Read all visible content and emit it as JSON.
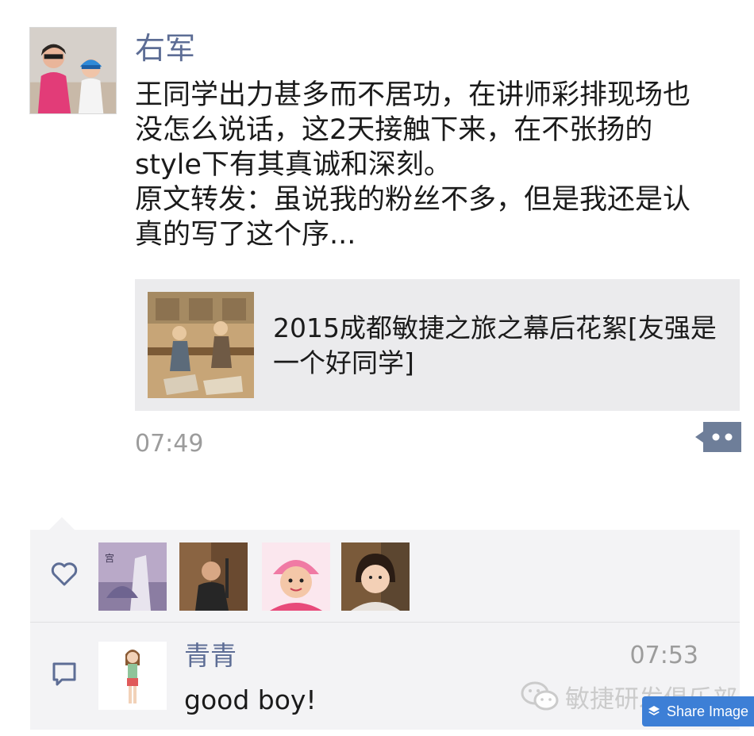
{
  "post": {
    "username": "右军",
    "text": "王同学出力甚多而不居功，在讲师彩排现场也\n没怎么说话，这2天接触下来，在不张扬的\nstyle下有其真诚和深刻。\n原文转发：虽说我的粉丝不多，但是我还是认\n真的写了这个序...",
    "link_title": "2015成都敏捷之旅之幕后花絮[友强是一个好同学]",
    "timestamp": "07:49"
  },
  "likes": {
    "icon": "heart-icon",
    "avatars": [
      "liker-1",
      "liker-2",
      "liker-3",
      "liker-4"
    ]
  },
  "comments": [
    {
      "name": "青青",
      "time": "07:53",
      "text": "good boy!"
    }
  ],
  "watermark": "敏捷研发俱乐部",
  "share_button": "Share Image",
  "colors": {
    "name_link": "#5d6d95",
    "share_button": "#3d7fd6",
    "card_bg": "#ebebed"
  }
}
